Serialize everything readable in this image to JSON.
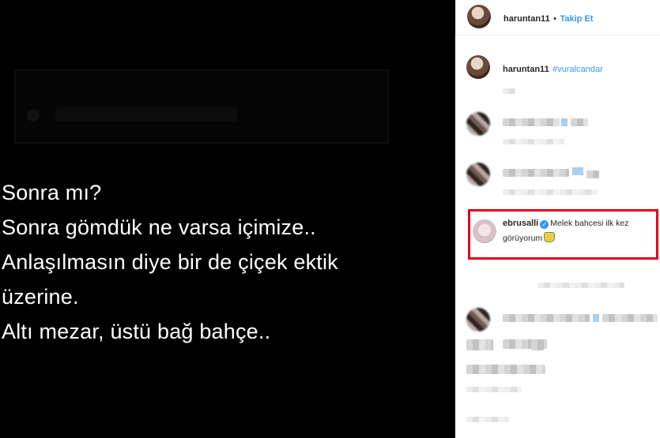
{
  "post": {
    "lines": [
      "Sonra mı?",
      "Sonra gömdük ne varsa içimize..",
      "Anlaşılmasın diye bir de çiçek ektik",
      "üzerine.",
      "Altı mezar, üstü bağ bahçe.."
    ]
  },
  "header": {
    "username": "haruntan11",
    "separator": "•",
    "follow_label": "Takip Et"
  },
  "caption": {
    "username": "haruntan11",
    "hashtag": "#vuralcandar"
  },
  "highlighted_comment": {
    "username": "ebrusalli",
    "verified_mark": "✓",
    "text_line1": "Melek bahcesi ilk kez",
    "text_line2": "görüyorum",
    "emoji": "smiling-face-emoji"
  },
  "colors": {
    "link_blue": "#3897f0",
    "highlight_red": "#e3001b"
  }
}
